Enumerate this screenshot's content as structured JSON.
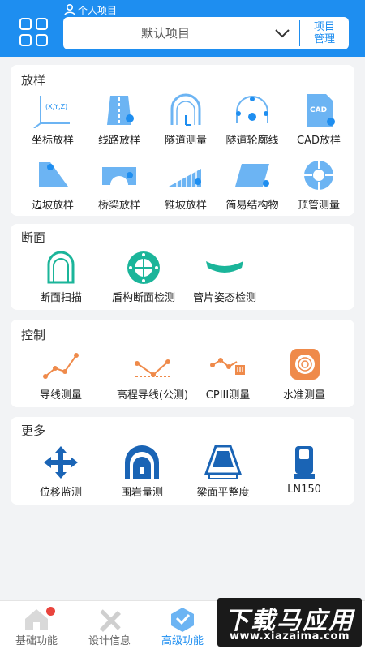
{
  "colors": {
    "accent": "#1e8ef0",
    "light_blue": "#6cb4f3",
    "green": "#1bb59a",
    "orange": "#ef8a4a",
    "badge_red": "#e9443d"
  },
  "header": {
    "project_label": "个人项目",
    "project_value": "默认项目",
    "manage_line1": "项目",
    "manage_line2": "管理"
  },
  "sections": {
    "stakeout": {
      "title": "放样",
      "items": [
        {
          "label": "坐标放样",
          "icon": "coordinate-axes-icon",
          "glyph": "(X,Y,Z)"
        },
        {
          "label": "线路放样",
          "icon": "road-icon"
        },
        {
          "label": "隧道测量",
          "icon": "tunnel-icon"
        },
        {
          "label": "隧道轮廓线",
          "icon": "tunnel-contour-icon"
        },
        {
          "label": "CAD放样",
          "icon": "cad-file-icon",
          "glyph": "CAD"
        },
        {
          "label": "边坡放样",
          "icon": "slope-icon"
        },
        {
          "label": "桥梁放样",
          "icon": "bridge-icon"
        },
        {
          "label": "锥坡放样",
          "icon": "cone-slope-icon"
        },
        {
          "label": "简易结构物",
          "icon": "simple-structure-icon"
        },
        {
          "label": "顶管测量",
          "icon": "pipe-jacking-icon"
        }
      ]
    },
    "section": {
      "title": "断面",
      "items": [
        {
          "label": "断面扫描",
          "icon": "section-scan-icon"
        },
        {
          "label": "盾构断面检测",
          "icon": "shield-section-icon"
        },
        {
          "label": "管片姿态检测",
          "icon": "segment-pose-icon"
        }
      ]
    },
    "control": {
      "title": "控制",
      "items": [
        {
          "label": "导线测量",
          "icon": "traverse-icon"
        },
        {
          "label": "高程导线(公测)",
          "icon": "elevation-traverse-icon"
        },
        {
          "label": "CPIII测量",
          "icon": "cpiii-icon"
        },
        {
          "label": "水准测量",
          "icon": "leveling-icon"
        }
      ]
    },
    "more": {
      "title": "更多",
      "items": [
        {
          "label": "位移监测",
          "icon": "displacement-icon"
        },
        {
          "label": "围岩量测",
          "icon": "surrounding-rock-icon"
        },
        {
          "label": "梁面平整度",
          "icon": "beam-flatness-icon"
        },
        {
          "label": "LN150",
          "icon": "ln150-device-icon"
        }
      ]
    }
  },
  "tabbar": [
    {
      "label": "基础功能",
      "icon": "home-icon"
    },
    {
      "label": "设计信息",
      "icon": "design-ruler-icon"
    },
    {
      "label": "高级功能",
      "icon": "advanced-icon"
    }
  ],
  "watermark": {
    "title": "下载马应用",
    "url": "www.xiazaima.com"
  }
}
